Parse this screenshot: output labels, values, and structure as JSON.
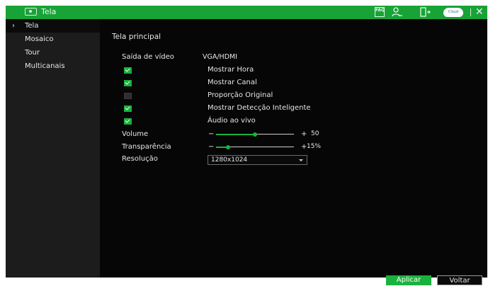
{
  "window": {
    "title": "Tela",
    "faq_label": "FAQ",
    "cloud_label": "Cloud"
  },
  "sidebar": {
    "items": [
      {
        "label": "Tela",
        "active": true
      },
      {
        "label": "Mosaico",
        "active": false
      },
      {
        "label": "Tour",
        "active": false
      },
      {
        "label": "Multicanais",
        "active": false
      }
    ]
  },
  "main": {
    "section_title": "Tela principal",
    "video_output_label": "Saída de vídeo",
    "video_output_value": "VGA/HDMI",
    "options": [
      {
        "label": "Mostrar Hora",
        "checked": true
      },
      {
        "label": "Mostrar Canal",
        "checked": true
      },
      {
        "label": "Proporção Original",
        "checked": false
      },
      {
        "label": "Mostrar Detecção Inteligente",
        "checked": true
      },
      {
        "label": "Áudio ao vivo",
        "checked": true
      }
    ],
    "volume": {
      "label": "Volume",
      "value": 50,
      "value_text": "50"
    },
    "transparency": {
      "label": "Transparência",
      "value": 15,
      "value_text": "15%"
    },
    "resolution": {
      "label": "Resolução",
      "value": "1280x1024"
    }
  },
  "actions": {
    "apply_label": "Aplicar",
    "back_label": "Voltar"
  },
  "colors": {
    "accent": "#19b23d",
    "titlebar": "#18a336",
    "background": "#060606",
    "sidebar": "#1c1c1c"
  }
}
